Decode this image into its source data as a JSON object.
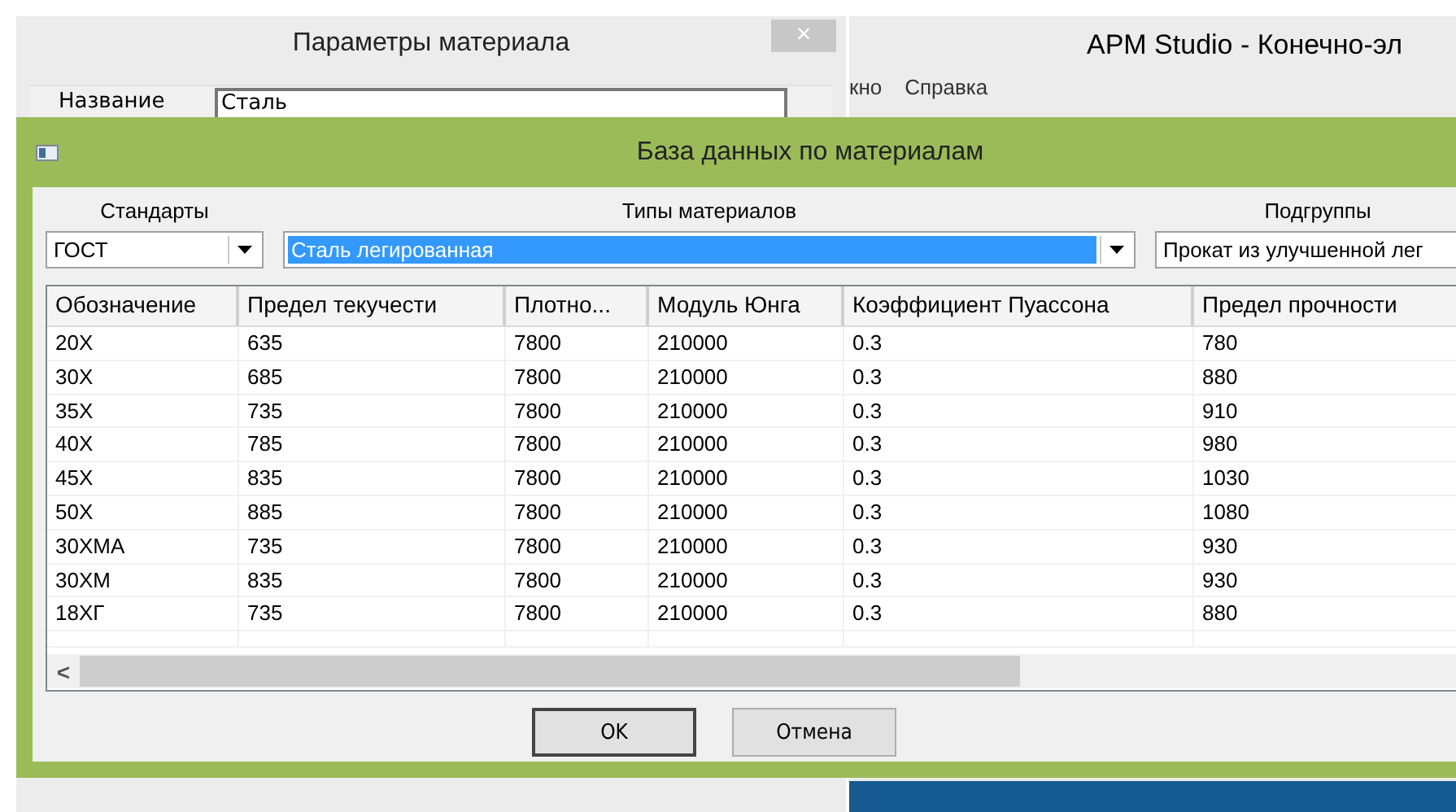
{
  "background_windows": [
    {
      "title": "Параметры материала",
      "close": "×",
      "field_label": "Название",
      "field_value": "Сталь"
    },
    {
      "title": "APM Studio - Конечно-эл",
      "menu": [
        "кно",
        "Справка"
      ]
    }
  ],
  "dialog": {
    "title": "База данных по материалам",
    "filters": [
      {
        "label": "Стандарты",
        "value": "ГОСТ",
        "highlighted": false,
        "arrow": true
      },
      {
        "label": "Типы материалов",
        "value": "Сталь легированная",
        "highlighted": true,
        "arrow": true
      },
      {
        "label": "Подгруппы",
        "value": "Прокат из улучшенной лег",
        "highlighted": false,
        "arrow": false
      }
    ],
    "table": {
      "columns": [
        "Обозначение",
        "Предел текучести",
        "Плотно...",
        "Модуль Юнга",
        "Коэффициент Пуассона",
        "Предел прочности"
      ],
      "rows": [
        [
          "20X",
          "635",
          "7800",
          "210000",
          "0.3",
          "780"
        ],
        [
          "30X",
          "685",
          "7800",
          "210000",
          "0.3",
          "880"
        ],
        [
          "35X",
          "735",
          "7800",
          "210000",
          "0.3",
          "910"
        ],
        [
          "40X",
          "785",
          "7800",
          "210000",
          "0.3",
          "980"
        ],
        [
          "45X",
          "835",
          "7800",
          "210000",
          "0.3",
          "1030"
        ],
        [
          "50X",
          "885",
          "7800",
          "210000",
          "0.3",
          "1080"
        ],
        [
          "30XMA",
          "735",
          "7800",
          "210000",
          "0.3",
          "930"
        ],
        [
          "30XM",
          "835",
          "7800",
          "210000",
          "0.3",
          "930"
        ],
        [
          "18XГ",
          "735",
          "7800",
          "210000",
          "0.3",
          "880"
        ]
      ],
      "scroll_arrow": "<"
    },
    "buttons": [
      "OK",
      "Отмена"
    ]
  }
}
